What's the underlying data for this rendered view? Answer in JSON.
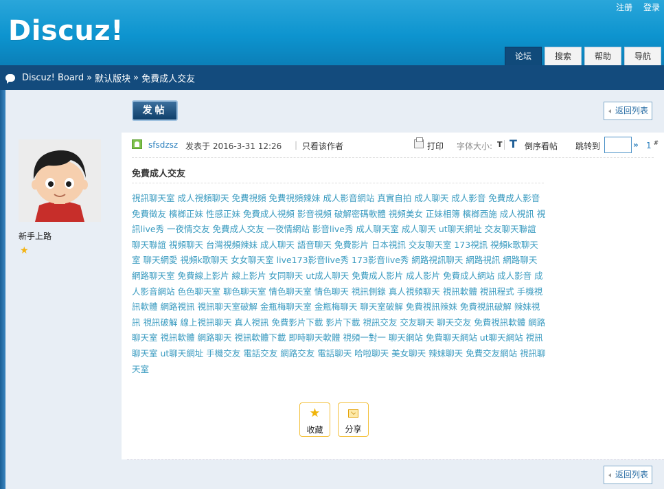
{
  "header": {
    "logo": "Discuz!",
    "top_links": [
      "注册",
      "登录"
    ],
    "nav_tabs": [
      {
        "label": "论坛",
        "active": true
      },
      {
        "label": "搜索",
        "active": false
      },
      {
        "label": "帮助",
        "active": false
      },
      {
        "label": "导航",
        "active": false
      }
    ]
  },
  "breadcrumb": {
    "items": [
      "Discuz! Board",
      "默认版块",
      "免費成人交友"
    ],
    "separator": "»"
  },
  "actions": {
    "new_post": "发帖",
    "back_to_list": "返回列表"
  },
  "author": {
    "rank_title": "新手上路",
    "rank_icon": "star-icon"
  },
  "post": {
    "author_name": "sfsdzsz",
    "posted_label": "发表于 2016-3-31 12:26",
    "divider": "|",
    "only_author": "只看该作者",
    "print": "打印",
    "font_size_label": "字体大小:",
    "font_small": "T",
    "font_big": "T",
    "reverse_order": "倒序看帖",
    "jump_to": "跳转到",
    "jump_arrow": "»",
    "floor": "1",
    "floor_mark": "#",
    "title": "免費成人交友",
    "body": "視訊聊天室 成人視頻聊天 免費視頻 免費視頻辣妹 成人影音網站 真實自拍 成人聊天 成人影音 免費成人影音 免費徵友 檳榔正妹 性感正妹 免費成人視頻 影音視頻 破解密碼軟體 視頻美女 正妹相簿 檳榔西施 成人視訊 視訊live秀 一夜情交友 免費成人交友 一夜情網站 影音live秀 成人聊天室 成人聊天 ut聊天網址 交友聊天聯誼 聊天聯誼 視頻聊天 台灣視頻辣妹 成人聊天 語音聊天 免費影片 日本視訊 交友聊天室 173視訊 視頻k歌聊天室 聊天網愛 視頻k歌聊天 女女聊天室 live173影音live秀 173影音live秀 網路視訊聊天 網路視訊 網路聊天 網路聊天室 免費線上影片 線上影片 女同聊天 ut成人聊天 免費成人影片 成人影片 免費成人網站 成人影音 成人影音網站 色色聊天室 聊色聊天室 情色聊天室 情色聊天 視訊側錄 真人視頻聊天 視訊軟體 視訊程式 手機視訊軟體 網路視訊 視訊聊天室破解 金瓶梅聊天室 金瓶梅聊天 聊天室破解 免費視訊辣妹 免費視訊破解 辣妹視訊 視訊破解 線上視訊聊天 真人視訊 免費影片下載 影片下載 視訊交友 交友聊天 聊天交友 免費視訊軟體 網路聊天室 視訊軟體 網路聊天 視訊軟體下載 即時聊天軟體 視頻一對一 聊天網站 免費聊天網站 ut聊天網站 視訊聊天室 ut聊天網址 手機交友 電話交友 網路交友 電話聊天 哈啦聊天 美女聊天 辣妹聊天 免費交友網站 視訊聊天室",
    "favorite": "收藏",
    "share": "分享"
  },
  "colors": {
    "header_blue": "#0d94cf",
    "nav_dark": "#134b7d",
    "link": "#2a7fbd",
    "body_text": "#3a9bc0",
    "accent_yellow": "#f3c03a"
  }
}
